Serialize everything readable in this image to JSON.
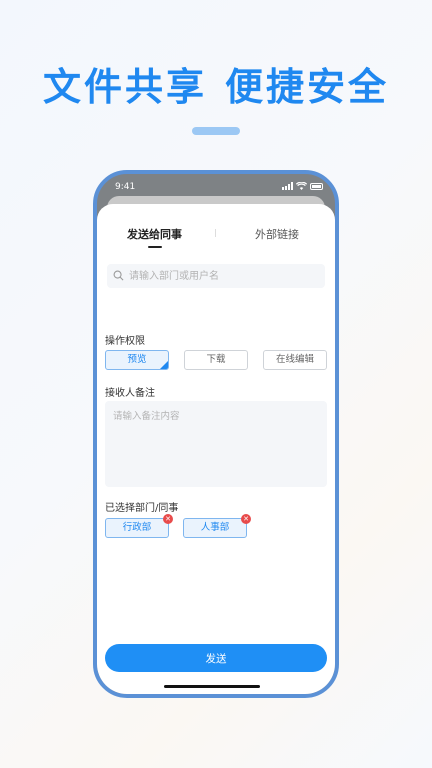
{
  "headline": {
    "part1": "文件共享",
    "part2": "便捷安全"
  },
  "status_bar": {
    "time": "9:41"
  },
  "tabs": [
    {
      "label": "发送给同事",
      "active": true
    },
    {
      "label": "外部链接",
      "active": false
    }
  ],
  "search": {
    "placeholder": "请输入部门或用户名"
  },
  "permissions": {
    "label": "操作权限",
    "options": [
      {
        "label": "预览",
        "selected": true
      },
      {
        "label": "下载",
        "selected": false
      },
      {
        "label": "在线编辑",
        "selected": false
      }
    ]
  },
  "remark": {
    "label": "接收人备注",
    "placeholder": "请输入备注内容"
  },
  "selected": {
    "label": "已选择部门/同事",
    "items": [
      {
        "label": "行政部"
      },
      {
        "label": "人事部"
      }
    ]
  },
  "send_button": {
    "label": "发送"
  },
  "colors": {
    "accent": "#1f88f0",
    "frame": "#5b91d6",
    "remove": "#e84b4b"
  }
}
